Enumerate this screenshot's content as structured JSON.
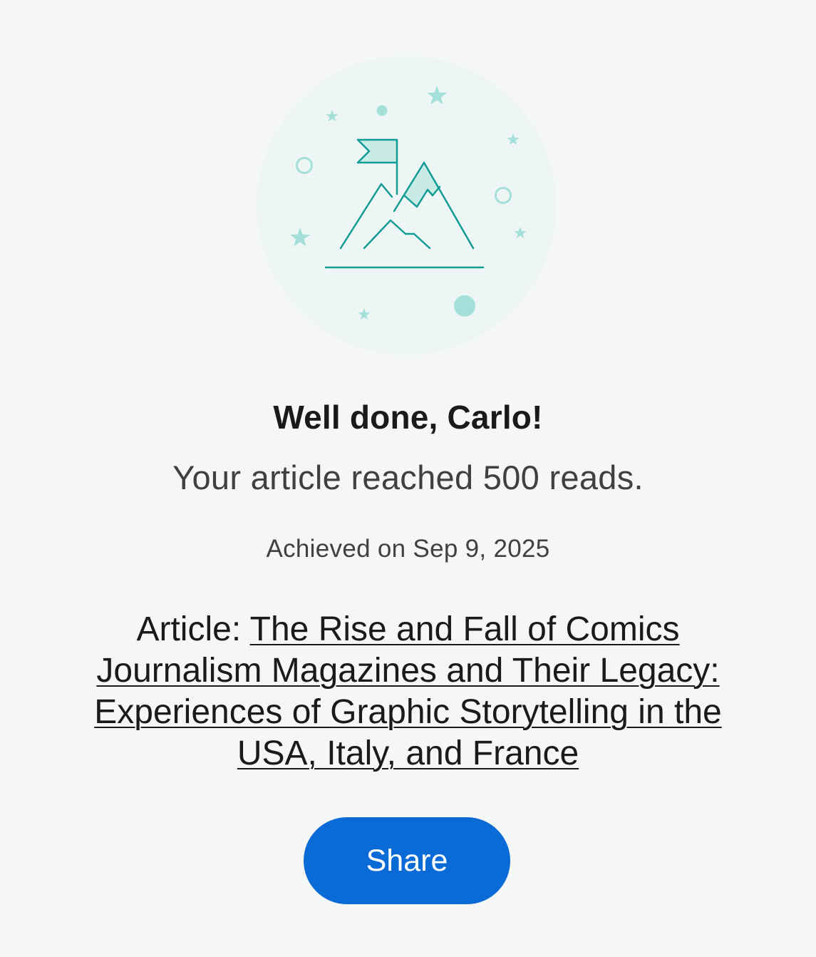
{
  "illustration": {
    "name": "mountain-summit-flag",
    "colors": {
      "background": "#eef6f5",
      "line": "#139c94",
      "accent": "#a4e0d9",
      "fill": "#c9ebe6"
    }
  },
  "milestone": {
    "title": "Well done, Carlo!",
    "message": "Your article reached 500 reads.",
    "achieved": "Achieved on Sep 9, 2025"
  },
  "article": {
    "prefix": "Article: ",
    "title": "The Rise and Fall of Comics Journalism Magazines and Their Legacy: Experiences of Graphic Storytelling in the USA, Italy, and France"
  },
  "actions": {
    "share_label": "Share"
  },
  "colors": {
    "page_background": "#f5f6f6",
    "primary": "#0a6ad6",
    "text": "#1a1a1a",
    "muted_text": "#404040"
  }
}
